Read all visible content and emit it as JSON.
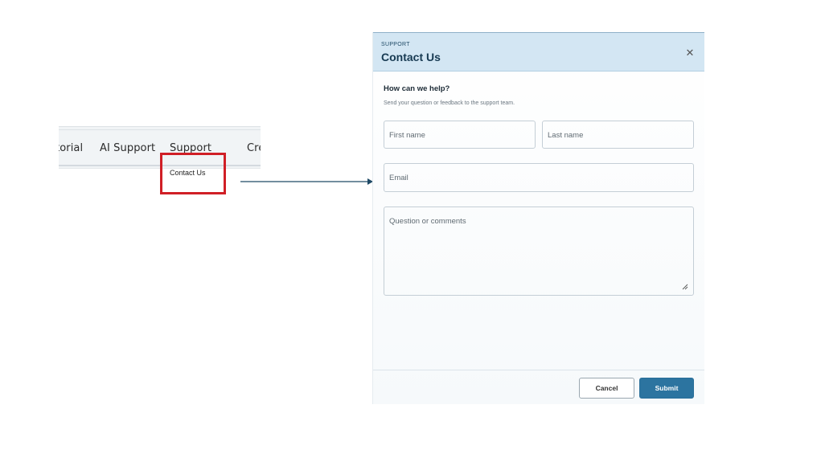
{
  "nav": {
    "items": [
      {
        "label": "torial"
      },
      {
        "label": "AI Support"
      },
      {
        "label": "Support"
      },
      {
        "label": "Cre"
      }
    ],
    "dropdown": {
      "contact_us": "Contact Us"
    }
  },
  "colors": {
    "highlight": "#d01f26",
    "header_bg": "#d3e6f3",
    "primary": "#2c74a0",
    "arrow": "#1f4a66"
  },
  "dialog": {
    "eyebrow": "SUPPORT",
    "title": "Contact Us",
    "close_icon": "close-icon",
    "heading": "How can we help?",
    "subtext": "Send your question or feedback to the support team.",
    "fields": {
      "first_name_placeholder": "First name",
      "last_name_placeholder": "Last name",
      "email_placeholder": "Email",
      "comments_placeholder": "Question or comments"
    },
    "buttons": {
      "cancel": "Cancel",
      "submit": "Submit"
    }
  }
}
